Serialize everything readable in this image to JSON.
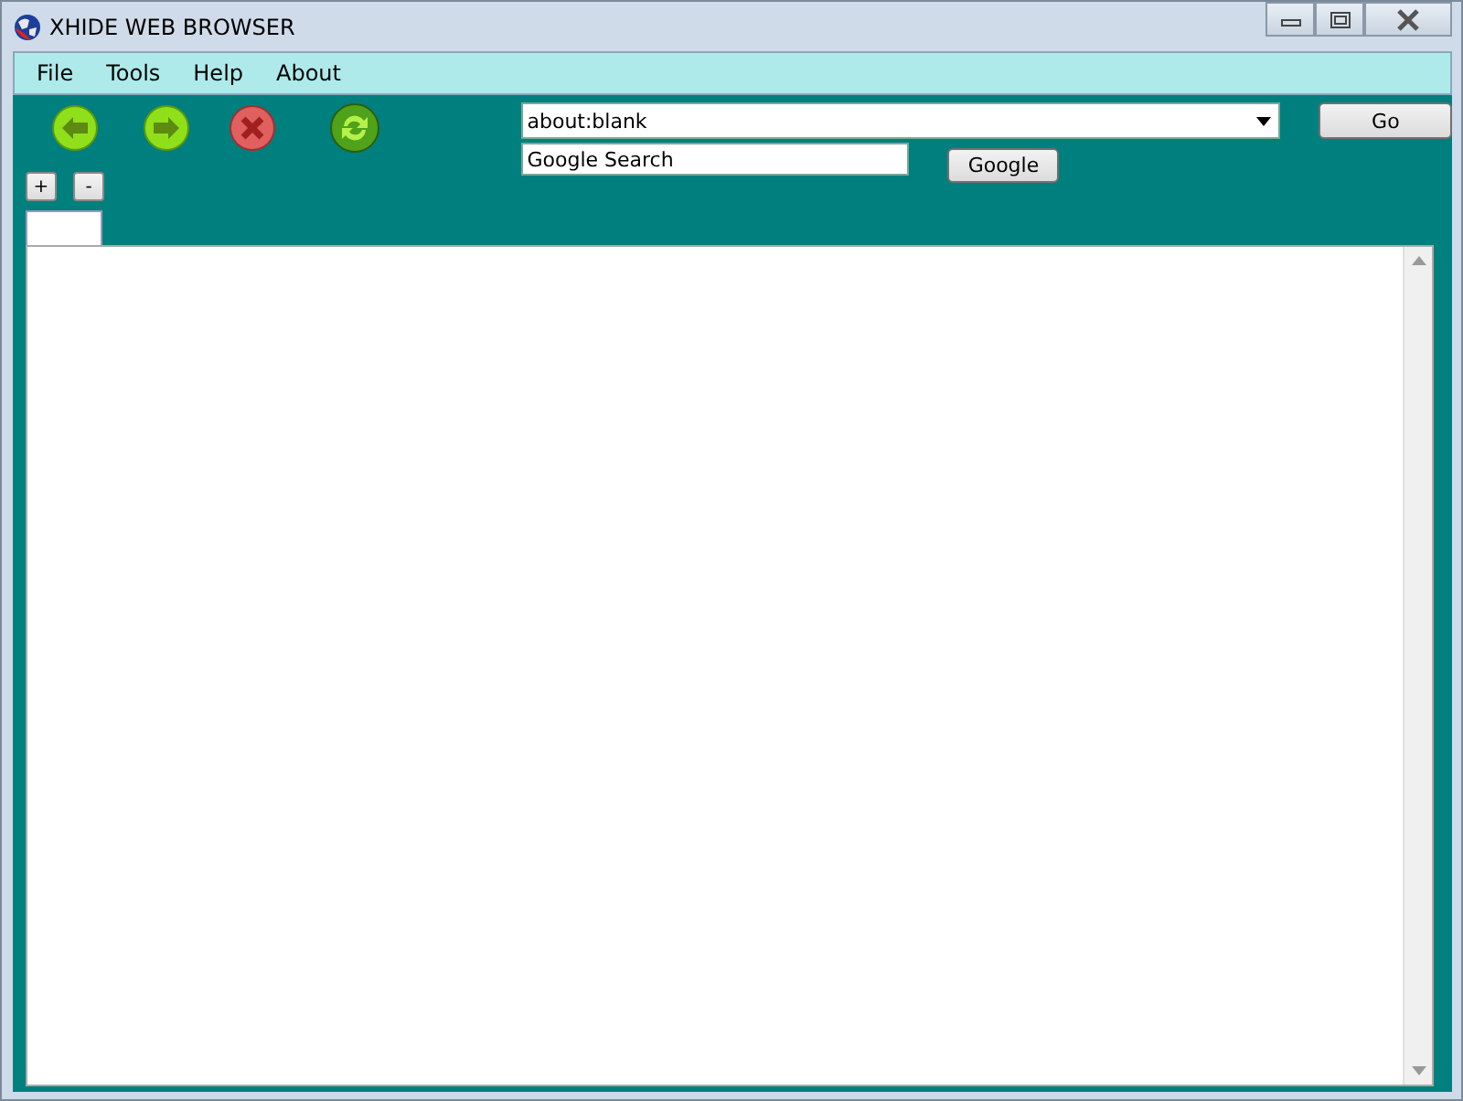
{
  "window": {
    "title": "XHIDE WEB BROWSER"
  },
  "menu": [
    "File",
    "Tools",
    "Help",
    "About"
  ],
  "address": {
    "value": "about:blank"
  },
  "go_button": "Go",
  "search": {
    "value": "Google Search"
  },
  "search_button": "Google",
  "zoom_buttons": [
    "+",
    "-"
  ]
}
